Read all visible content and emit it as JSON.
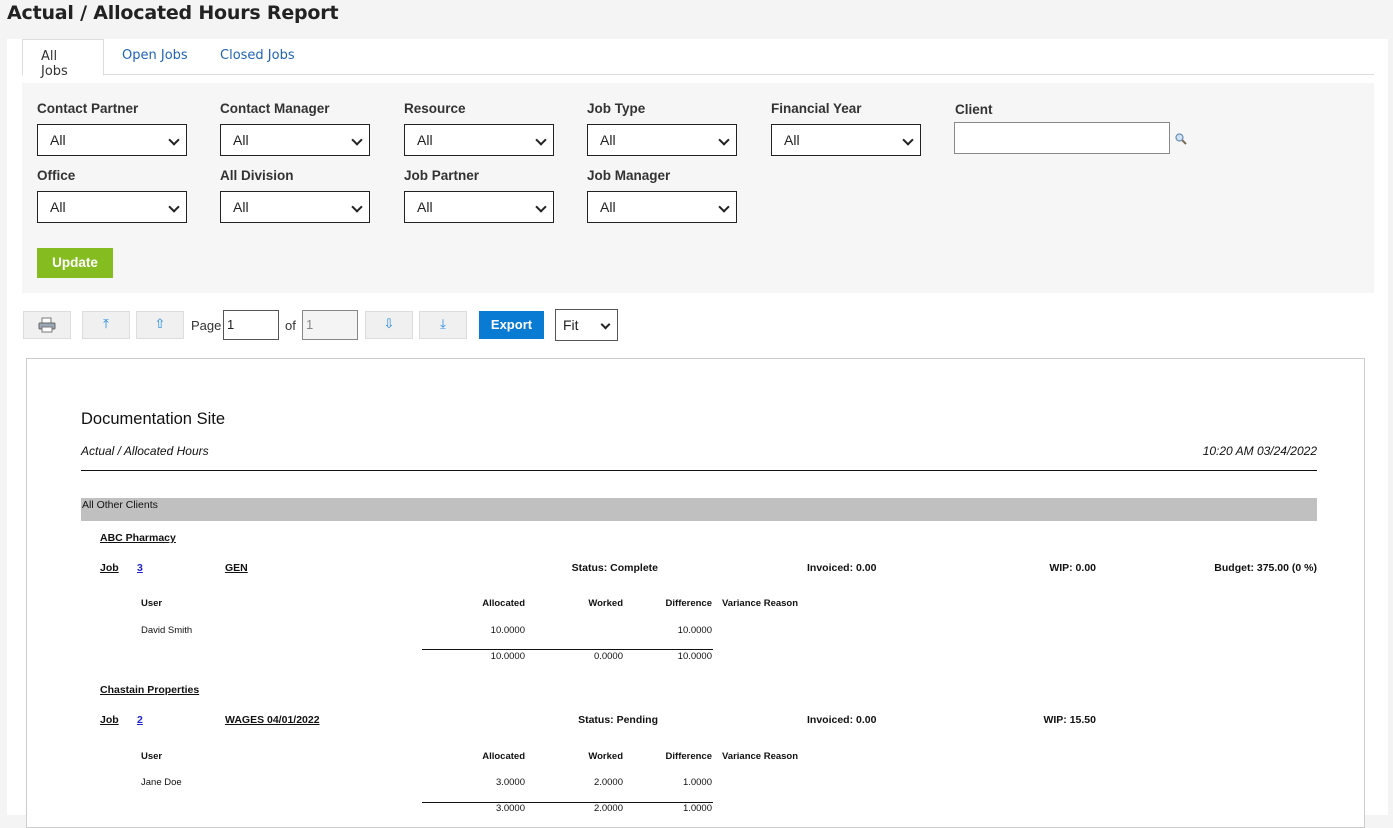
{
  "page": {
    "title": "Actual / Allocated Hours Report"
  },
  "tabs": [
    {
      "label": "All Jobs",
      "active": true
    },
    {
      "label": "Open Jobs",
      "active": false
    },
    {
      "label": "Closed Jobs",
      "active": false
    }
  ],
  "filters": {
    "contact_partner": {
      "label": "Contact Partner",
      "value": "All"
    },
    "contact_manager": {
      "label": "Contact Manager",
      "value": "All"
    },
    "resource": {
      "label": "Resource",
      "value": "All"
    },
    "job_type": {
      "label": "Job Type",
      "value": "All"
    },
    "financial_year": {
      "label": "Financial Year",
      "value": "All"
    },
    "client": {
      "label": "Client",
      "value": ""
    },
    "office": {
      "label": "Office",
      "value": "All"
    },
    "all_division": {
      "label": "All Division",
      "value": "All"
    },
    "job_partner": {
      "label": "Job Partner",
      "value": "All"
    },
    "job_manager": {
      "label": "Job Manager",
      "value": "All"
    },
    "update_label": "Update"
  },
  "toolbar": {
    "page_label": "Page",
    "page_value": "1",
    "of_label": "of",
    "total_pages": "1",
    "export_label": "Export",
    "zoom_value": "Fit",
    "icons": [
      "printer-icon",
      "first-page-icon",
      "previous-page-icon",
      "next-page-icon",
      "last-page-icon"
    ]
  },
  "report": {
    "site_name": "Documentation Site",
    "report_name": "Actual / Allocated Hours",
    "timestamp": "10:20 AM 03/24/2022",
    "group": "All Other Clients",
    "col_user": "User",
    "col_allocated": "Allocated",
    "col_worked": "Worked",
    "col_difference": "Difference",
    "col_variance": "Variance Reason",
    "job_label": "Job",
    "clients": [
      {
        "name": "ABC Pharmacy",
        "job_no": "3",
        "job_name": "GEN",
        "status": "Status: Complete",
        "invoiced": "Invoiced: 0.00",
        "wip": "WIP: 0.00",
        "budget": "Budget: 375.00 (0 %)",
        "rows": [
          {
            "user": "David Smith",
            "allocated": "10.0000",
            "worked": "",
            "difference": "10.0000"
          }
        ],
        "totals": {
          "allocated": "10.0000",
          "worked": "0.0000",
          "difference": "10.0000"
        }
      },
      {
        "name": "Chastain Properties",
        "job_no": "2",
        "job_name": "WAGES 04/01/2022",
        "status": "Status: Pending",
        "invoiced": "Invoiced: 0.00",
        "wip": "WIP: 15.50",
        "budget": "",
        "rows": [
          {
            "user": "Jane Doe",
            "allocated": "3.0000",
            "worked": "2.0000",
            "difference": "1.0000"
          }
        ],
        "totals": {
          "allocated": "3.0000",
          "worked": "2.0000",
          "difference": "1.0000"
        }
      }
    ]
  }
}
